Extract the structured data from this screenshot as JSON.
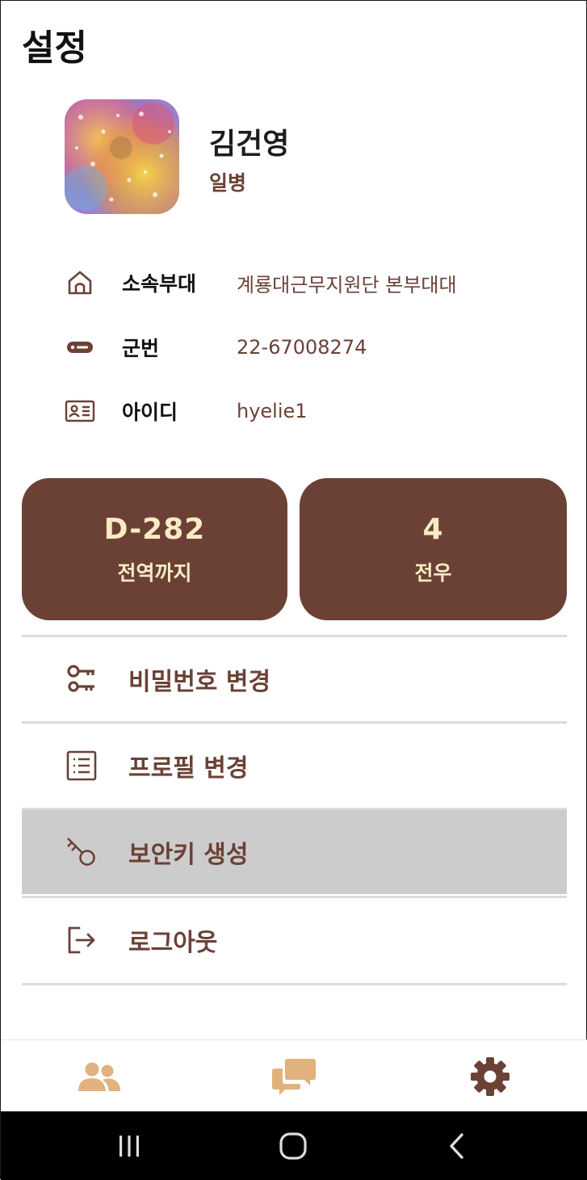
{
  "header": {
    "title": "설정"
  },
  "profile": {
    "name": "김건영",
    "rank": "일병"
  },
  "info": {
    "unit": {
      "label": "소속부대",
      "value": "계룡대근무지원단 본부대대",
      "icon": "home-icon"
    },
    "service_number": {
      "label": "군번",
      "value": "22-67008274",
      "icon": "dogtag-icon"
    },
    "user_id": {
      "label": "아이디",
      "value": "hyelie1",
      "icon": "id-card-icon"
    }
  },
  "stats": {
    "discharge": {
      "value": "D-282",
      "label": "전역까지"
    },
    "comrades": {
      "value": "4",
      "label": "전우"
    }
  },
  "menu": [
    {
      "label": "비밀번호 변경",
      "icon": "key-icon"
    },
    {
      "label": "프로필 변경",
      "icon": "list-icon"
    },
    {
      "label": "보안키 생성",
      "icon": "security-key-icon"
    },
    {
      "label": "로그아웃",
      "icon": "logout-icon"
    }
  ],
  "tabs": [
    {
      "icon": "people-icon",
      "color": "#e2b27e"
    },
    {
      "icon": "chat-icon",
      "color": "#e2b27e"
    },
    {
      "icon": "gear-icon",
      "color": "#6b4136"
    }
  ],
  "colors": {
    "brand": "#6b4136",
    "accent": "#fbeac4",
    "tab_inactive": "#e2b27e",
    "selected_row": "#cccccc"
  }
}
